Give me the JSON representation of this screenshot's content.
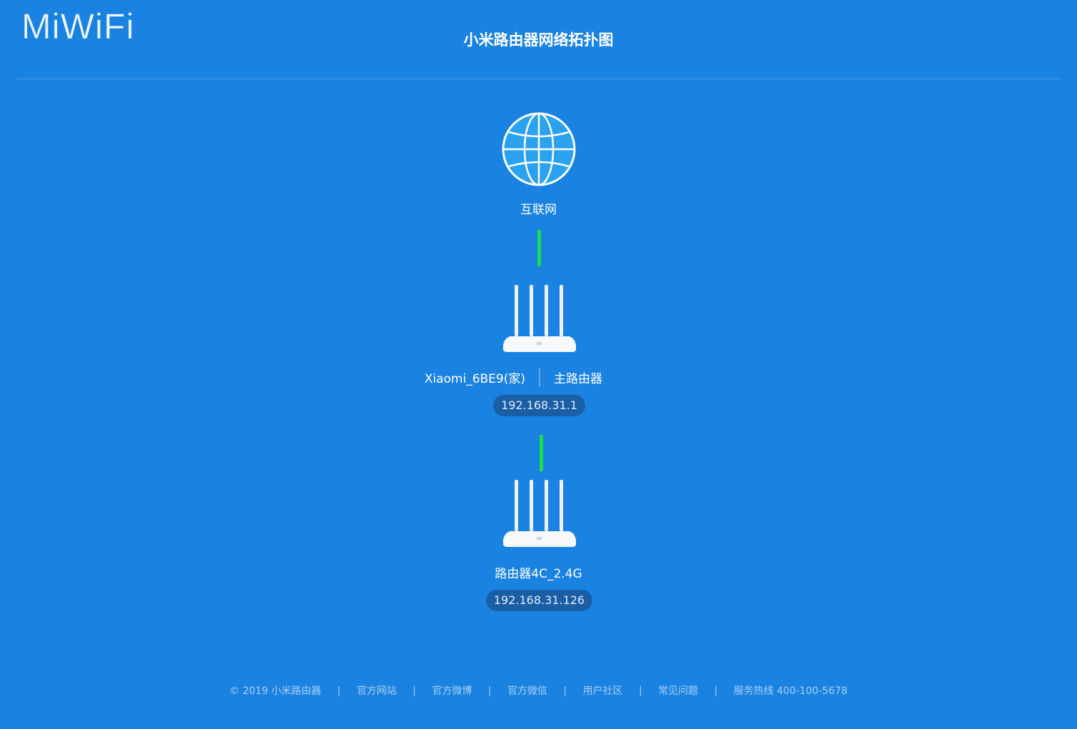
{
  "app": {
    "logo_text": "MiWiFi",
    "title": "小米路由器网络拓扑图"
  },
  "internet": {
    "label": "互联网",
    "icon": "globe-icon"
  },
  "main_router": {
    "name": "Xiaomi_6BE9(家)",
    "role": "主路由器",
    "ip": "192.168.31.1",
    "icon": "router-icon"
  },
  "sub_router": {
    "name": "路由器4C_2.4G",
    "ip": "192.168.31.126",
    "icon": "router-icon"
  },
  "colors": {
    "background": "#1a82e0",
    "link_ok": "#19e04a",
    "ip_pill": "#1a5ea6"
  },
  "footer": {
    "copyright": "© 2019 小米路由器",
    "links": [
      "官方网站",
      "官方微博",
      "官方微信",
      "用户社区",
      "常见问题"
    ],
    "hotline": "服务热线 400-100-5678",
    "separator": "|"
  }
}
